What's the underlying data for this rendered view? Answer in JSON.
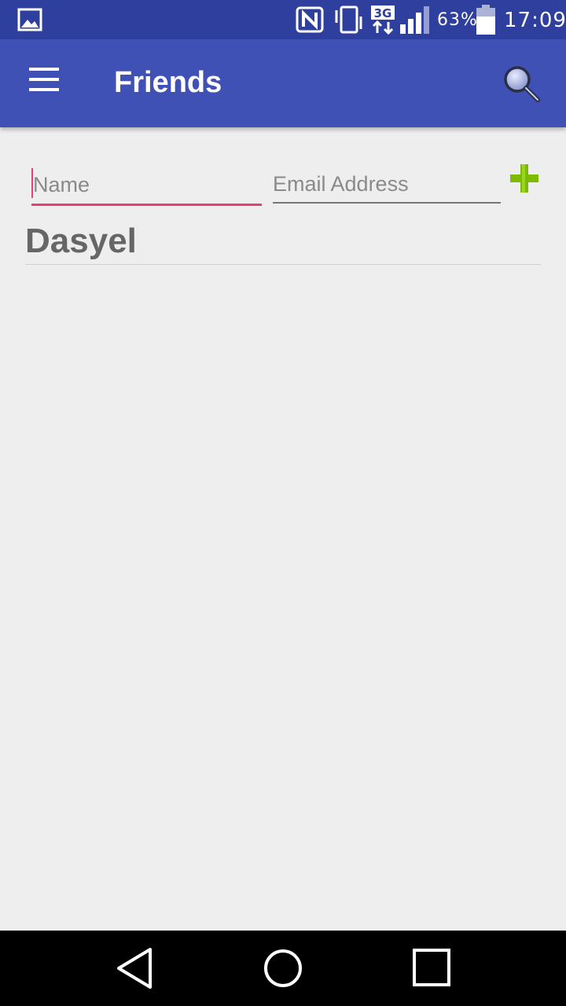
{
  "status_bar": {
    "icons": [
      "gallery-icon",
      "nfc-icon",
      "vibrate-icon",
      "3g-icon",
      "signal-icon",
      "battery-icon"
    ],
    "network": "3G",
    "battery_percent": "63%",
    "time": "17:09"
  },
  "app_bar": {
    "title": "Friends",
    "menu_icon": "hamburger-menu-icon",
    "search_icon": "search-icon",
    "color": "#3f51b5"
  },
  "form": {
    "name_placeholder": "Name",
    "name_value": "",
    "email_placeholder": "Email Address",
    "email_value": "",
    "add_icon": "plus-icon",
    "accent_color": "#e5407a",
    "add_color": "#7cbb00"
  },
  "friends": [
    {
      "name": "Dasyel"
    }
  ],
  "nav_bar": {
    "icons": [
      "back-icon",
      "home-icon",
      "recents-icon"
    ]
  }
}
